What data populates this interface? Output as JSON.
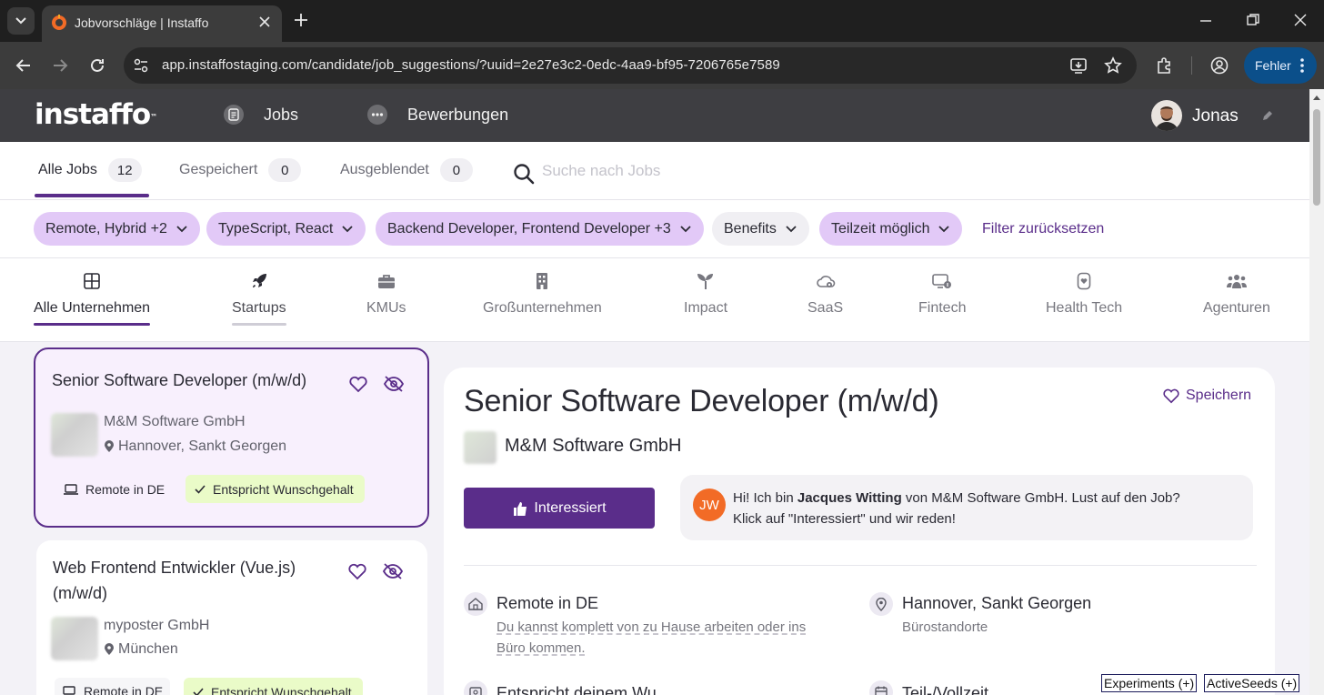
{
  "browser": {
    "tab_title": "Jobvorschläge | Instaffo",
    "url": "app.instaffostaging.com/candidate/job_suggestions/?uuid=2e27e3c2-0edc-4aa9-bf95-7206765e7589",
    "error_button": "Fehler"
  },
  "header": {
    "logo": "instaffo",
    "logo_tm": "™",
    "nav": [
      {
        "label": "Jobs",
        "icon": "document-icon"
      },
      {
        "label": "Bewerbungen",
        "icon": "chat-bubble-icon"
      }
    ],
    "user_name": "Jonas"
  },
  "tabs": [
    {
      "label": "Alle Jobs",
      "count": "12",
      "active": true
    },
    {
      "label": "Gespeichert",
      "count": "0",
      "active": false
    },
    {
      "label": "Ausgeblendet",
      "count": "0",
      "active": false
    }
  ],
  "search": {
    "placeholder": "Suche nach Jobs",
    "value": ""
  },
  "filters": [
    {
      "label": "Remote, Hybrid +2",
      "active": true
    },
    {
      "label": "TypeScript, React",
      "active": true
    },
    {
      "label": "Backend Developer, Frontend Developer +3",
      "active": true
    },
    {
      "label": "Benefits",
      "active": false
    },
    {
      "label": "Teilzeit möglich",
      "active": true
    }
  ],
  "reset_filters": "Filter zurücksetzen",
  "categories": [
    {
      "label": "Alle Unternehmen",
      "icon": "grid-icon",
      "state": "active"
    },
    {
      "label": "Startups",
      "icon": "rocket-icon",
      "state": "hover"
    },
    {
      "label": "KMUs",
      "icon": "briefcase-icon",
      "state": ""
    },
    {
      "label": "Großunternehmen",
      "icon": "building-icon",
      "state": ""
    },
    {
      "label": "Impact",
      "icon": "sprout-icon",
      "state": ""
    },
    {
      "label": "SaaS",
      "icon": "cloud-gear-icon",
      "state": ""
    },
    {
      "label": "Fintech",
      "icon": "monitor-coin-icon",
      "state": ""
    },
    {
      "label": "Health Tech",
      "icon": "heart-device-icon",
      "state": ""
    },
    {
      "label": "Agenturen",
      "icon": "people-icon",
      "state": ""
    }
  ],
  "jobs": [
    {
      "title": "Senior Software Developer (m/w/d)",
      "company": "M&M Software GmbH",
      "location": "Hannover, Sankt Georgen",
      "remote": "Remote in DE",
      "salary_badge": "Entspricht Wunschgehalt"
    },
    {
      "title_line1": "Web Frontend Entwickler (Vue.js)",
      "title_line2": "(m/w/d)",
      "company": "myposter GmbH",
      "location": "München",
      "remote": "Remote in DE",
      "salary_badge": "Entspricht Wunschgehalt"
    }
  ],
  "detail": {
    "title": "Senior Software Developer (m/w/d)",
    "save": "Speichern",
    "company": "M&M Software GmbH",
    "interest_button": "Interessiert",
    "recruiter_initials": "JW",
    "chat_pre": "Hi! Ich bin ",
    "chat_name": "Jacques Witting",
    "chat_post": " von M&M Software GmbH. Lust auf den Job?",
    "chat_line2": "Klick auf \"Interessiert\" und wir reden!",
    "features": [
      {
        "title": "Remote in DE",
        "sub_line1": "Du kannst komplett von zu Hause arbeiten oder ins",
        "sub_line2": "Büro kommen."
      },
      {
        "title": "Hannover, Sankt Georgen",
        "sub_line1": "Bürostandorte",
        "sub_line2": ""
      },
      {
        "title": "Entspricht deinem Wu",
        "sub_line1": "",
        "sub_line2": ""
      },
      {
        "title": "Teil-/Vollzeit",
        "sub_line1": "",
        "sub_line2": ""
      }
    ]
  },
  "debug": {
    "experiments": "Experiments (+)",
    "active_seeds": "ActiveSeeds (+)"
  },
  "colors": {
    "brand_purple": "#5a2d8a",
    "chip_active": "#e2c9f7",
    "salary_badge": "#eafbc8",
    "header_bg": "#3e3e42"
  }
}
